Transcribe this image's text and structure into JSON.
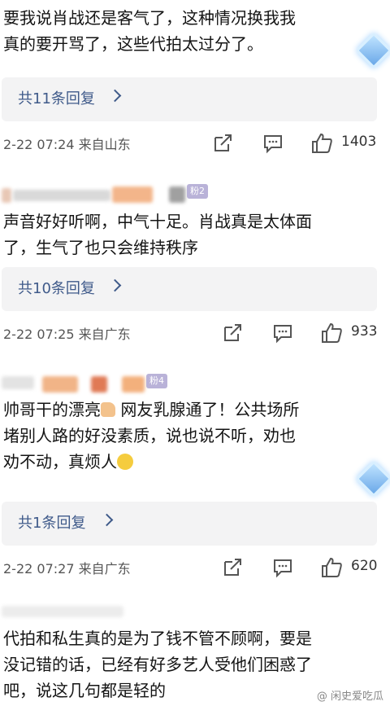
{
  "comments": [
    {
      "lines": [
        "要我说肖战还是客气了，这种情况换我我",
        "真的要开骂了，这些代拍太过分了。"
      ],
      "reply": "共11条回复",
      "time": "2-22 07:24",
      "location": "来自山东",
      "likes": "1403"
    },
    {
      "fan_badge": "粉2",
      "lines": [
        "声音好好听啊，中气十足。肖战真是太体面",
        "了，生气了也只会维持秩序"
      ],
      "reply": "共10条回复",
      "time": "2-22 07:25",
      "location": "来自广东",
      "likes": "933"
    },
    {
      "fan_badge": "粉4",
      "lines_a": "帅哥干的漂亮",
      "lines_b": " 网友乳腺通了！公共场所",
      "line2": "堵别人路的好没素质，说也说不听，劝也",
      "line3": "劝不动，真烦人",
      "reply": "共1条回复",
      "time": "2-22 07:27",
      "location": "来自广东",
      "likes": "620"
    },
    {
      "lines": [
        "代拍和私生真的是为了钱不管不顾啊，要是",
        "没记错的话，已经有好多艺人受他们困惑了",
        "吧，说这几句都是轻的"
      ]
    }
  ],
  "watermark": "@ 闲史爱吃瓜",
  "icons": {
    "share": "share-icon",
    "comment": "comment-icon",
    "like": "thumbs-up-icon",
    "chevron": "chevron-right-icon",
    "diamond": "diamond-badge-icon"
  }
}
